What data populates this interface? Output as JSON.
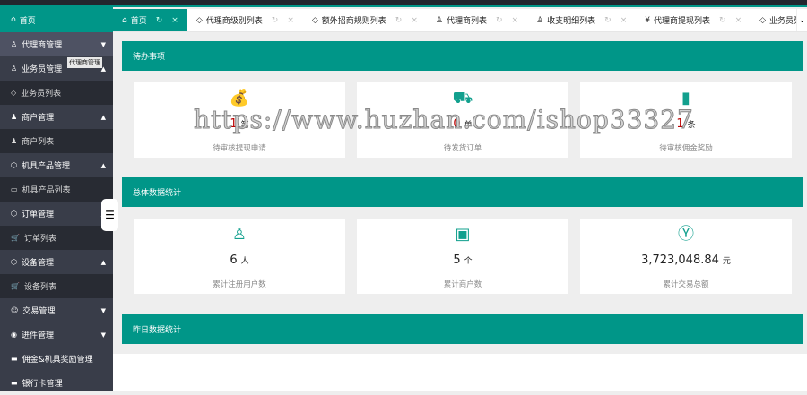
{
  "sidebar": {
    "home": "首页",
    "tooltip": "代理商管理",
    "items": [
      {
        "label": "代理商管理",
        "icon": "user-icon",
        "arrow": "▼"
      },
      {
        "label": "业务员管理",
        "icon": "user-icon",
        "arrow": "▲"
      },
      {
        "label": "业务员列表",
        "icon": "diamond-icon"
      },
      {
        "label": "商户管理",
        "icon": "users-icon",
        "arrow": "▲"
      },
      {
        "label": "商户列表",
        "icon": "users-icon"
      },
      {
        "label": "机具产品管理",
        "icon": "box-icon",
        "arrow": "▲"
      },
      {
        "label": "机具产品列表",
        "icon": "list-icon"
      },
      {
        "label": "订单管理",
        "icon": "box-icon",
        "arrow": "▲"
      },
      {
        "label": "订单列表",
        "icon": "cart-icon"
      },
      {
        "label": "设备管理",
        "icon": "box-icon",
        "arrow": "▲"
      },
      {
        "label": "设备列表",
        "icon": "cart-icon"
      },
      {
        "label": "交易管理",
        "icon": "smile-icon",
        "arrow": "▼"
      },
      {
        "label": "进件管理",
        "icon": "compass-icon",
        "arrow": "▼"
      },
      {
        "label": "佣金&机具奖励管理",
        "icon": "card-icon"
      },
      {
        "label": "银行卡管理",
        "icon": "card-icon"
      }
    ]
  },
  "tabs": [
    {
      "label": "首页",
      "icon": "home-icon"
    },
    {
      "label": "代理商级别列表",
      "icon": "diamond-icon"
    },
    {
      "label": "额外招商规则列表",
      "icon": "diamond-icon"
    },
    {
      "label": "代理商列表",
      "icon": "user-icon"
    },
    {
      "label": "收支明细列表",
      "icon": "user-icon"
    },
    {
      "label": "代理商提现列表",
      "icon": "yen-icon"
    },
    {
      "label": "业务员列表",
      "icon": "diamond-icon"
    }
  ],
  "sections": [
    {
      "title": "待办事项",
      "cards": [
        {
          "value": "1",
          "unit": "笔",
          "label": "待审核提现申请",
          "icon": "money-bag-icon"
        },
        {
          "value": "0",
          "unit": "单",
          "label": "待发货订单",
          "icon": "truck-icon"
        },
        {
          "value": "1",
          "unit": "条",
          "label": "待审核佣金奖励",
          "icon": "documents-icon"
        }
      ]
    },
    {
      "title": "总体数据统计",
      "cards": [
        {
          "value": "6",
          "unit": "人",
          "label": "累计注册用户数",
          "icon": "user-icon"
        },
        {
          "value": "5",
          "unit": "个",
          "label": "累计商户数",
          "icon": "window-icon"
        },
        {
          "value": "3,723,048.84",
          "unit": "元",
          "label": "累计交易总额",
          "icon": "yen-circle-icon"
        }
      ]
    },
    {
      "title": "昨日数据统计"
    }
  ],
  "watermark": "https://www.huzhan.com/ishop33327",
  "colors": {
    "accent": "#009688",
    "sidebar": "#393d49"
  }
}
